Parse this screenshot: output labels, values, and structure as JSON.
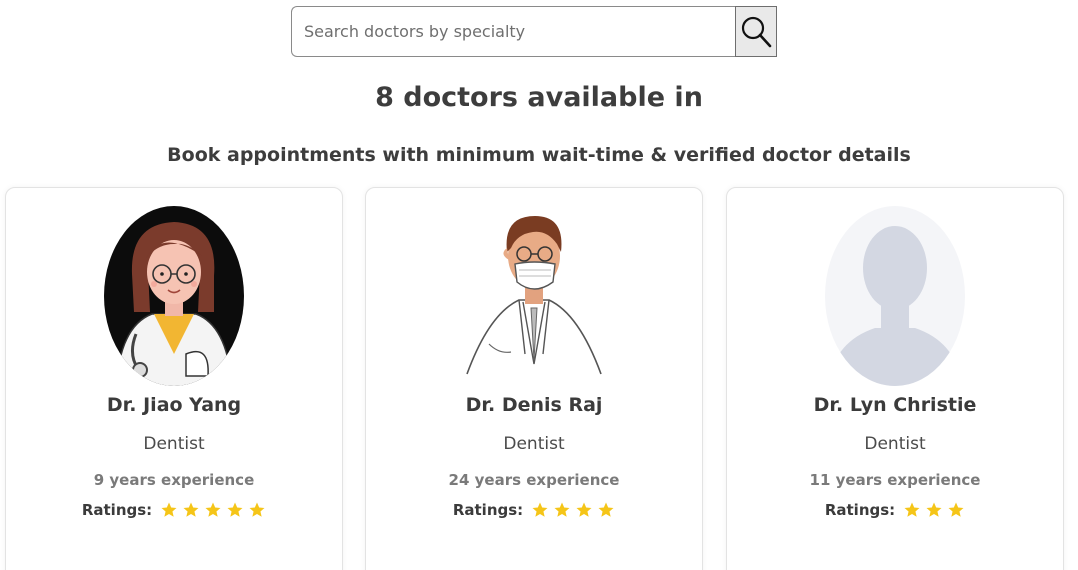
{
  "search": {
    "placeholder": "Search doctors by specialty",
    "value": "",
    "button_icon": "search-icon"
  },
  "heading": "8 doctors available in",
  "subheading": "Book appointments with minimum wait-time & verified doctor details",
  "colors": {
    "star": "#f5c518",
    "card_border": "#e3e3e3"
  },
  "doctors": [
    {
      "name": "Dr. Jiao Yang",
      "specialty": "Dentist",
      "experience": "9 years experience",
      "ratings_label": "Ratings:",
      "rating": 5,
      "avatar": "female-doctor-illustration"
    },
    {
      "name": "Dr. Denis Raj",
      "specialty": "Dentist",
      "experience": "24 years experience",
      "ratings_label": "Ratings:",
      "rating": 4,
      "avatar": "male-doctor-mask-illustration"
    },
    {
      "name": "Dr. Lyn Christie",
      "specialty": "Dentist",
      "experience": "11 years experience",
      "ratings_label": "Ratings:",
      "rating": 3,
      "avatar": "placeholder-person-silhouette"
    }
  ]
}
